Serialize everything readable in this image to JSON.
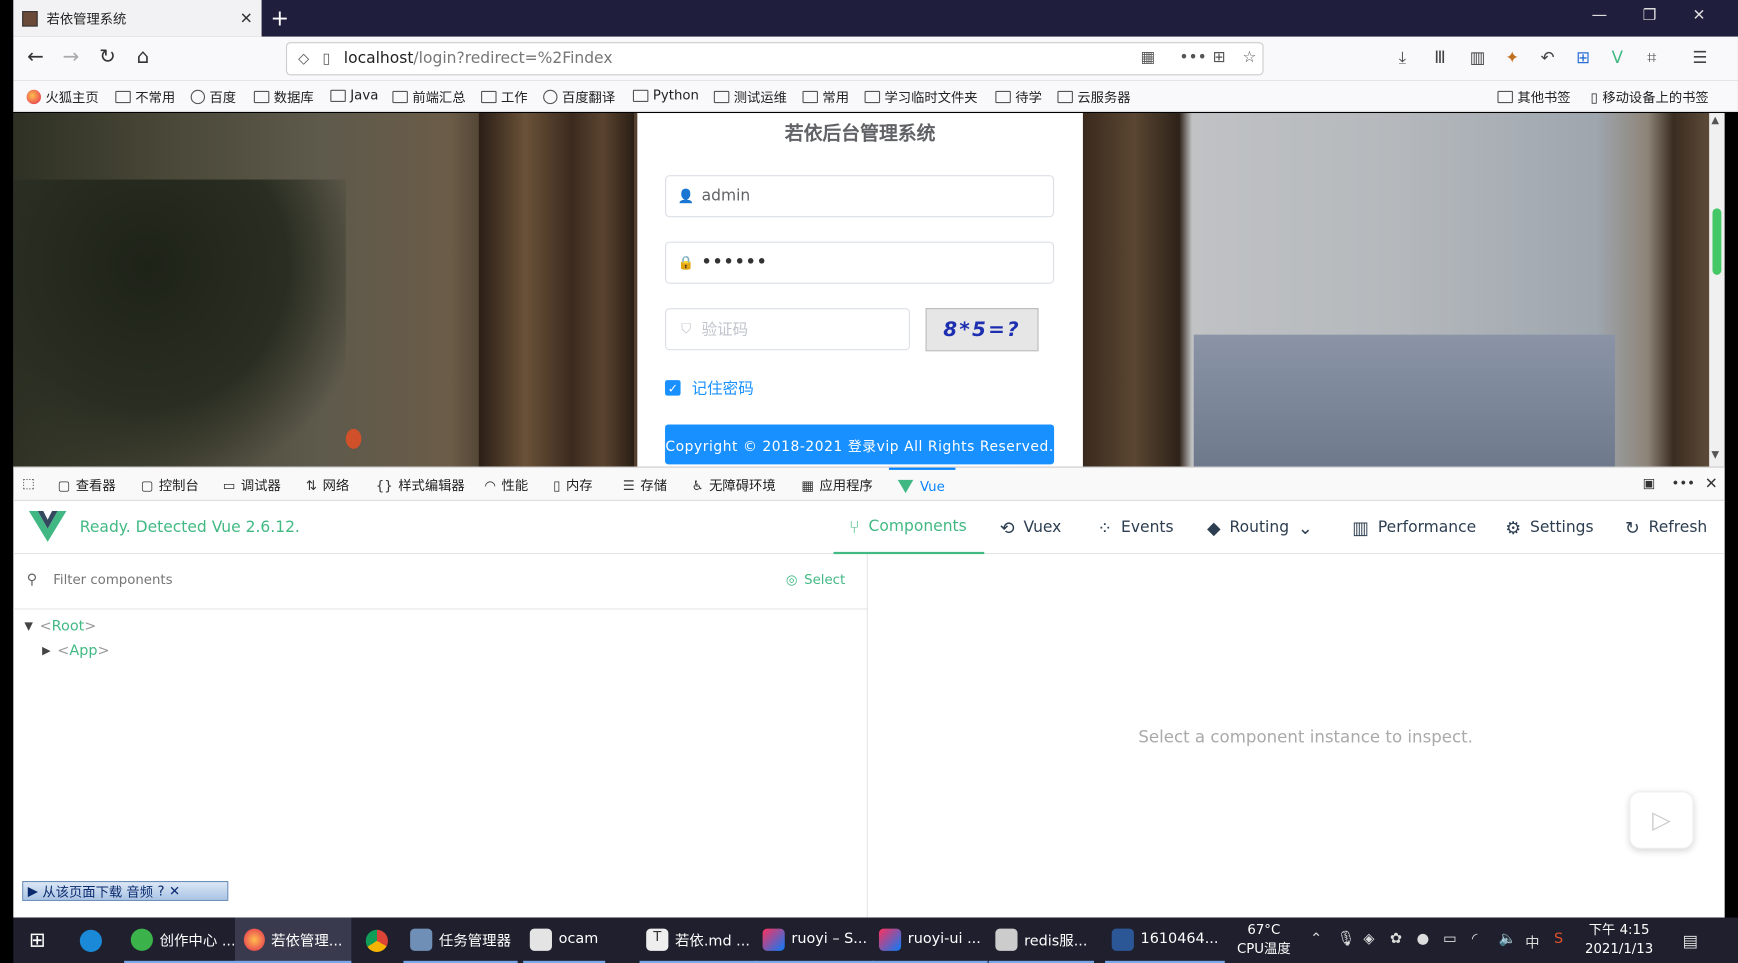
{
  "browser": {
    "tab_title": "若依管理系统",
    "url_host": "localhost",
    "url_path": "/login?redirect=%2Findex",
    "bookmarks": [
      "火狐主页",
      "不常用",
      "百度",
      "数据库",
      "Java",
      "前端汇总",
      "工作",
      "百度翻译",
      "Python",
      "测试运维",
      "常用",
      "学习临时文件夹",
      "待学",
      "云服务器"
    ],
    "bookmarks_right": [
      "其他书签",
      "移动设备上的书签"
    ]
  },
  "login": {
    "title": "若依后台管理系统",
    "username": "admin",
    "password": "••••••",
    "captcha_placeholder": "验证码",
    "captcha_text": "8*5=?",
    "remember_label": "记住密码",
    "footer": "Copyright © 2018-2021 登录vip All Rights Reserved."
  },
  "devtools": {
    "tabs": [
      "查看器",
      "控制台",
      "调试器",
      "网络",
      "样式编辑器",
      "性能",
      "内存",
      "存储",
      "无障碍环境",
      "应用程序",
      "Vue"
    ]
  },
  "vue": {
    "status": "Ready. Detected Vue 2.6.12.",
    "tabs": [
      "Components",
      "Vuex",
      "Events",
      "Routing",
      "Performance",
      "Settings",
      "Refresh"
    ],
    "filter_placeholder": "Filter components",
    "select_label": "Select",
    "tree": [
      {
        "name": "Root"
      },
      {
        "name": "App"
      }
    ],
    "inspect_hint": "Select a component instance to inspect.",
    "download_bar": "从该页面下载 音频"
  },
  "taskbar": {
    "apps": [
      "创作中心 ...",
      "若依管理...",
      "任务管理器",
      "ocam",
      "若依.md ...",
      "ruoyi – S...",
      "ruoyi-ui ...",
      "redis服...",
      "1610464..."
    ],
    "temp_value": "67°C",
    "temp_label": "CPU温度",
    "ime": "中",
    "time": "下午 4:15",
    "date": "2021/1/13"
  },
  "colors": {
    "vue_green": "#42b983",
    "link_blue": "#1890ff",
    "firefox_blue": "#0a84ff"
  }
}
